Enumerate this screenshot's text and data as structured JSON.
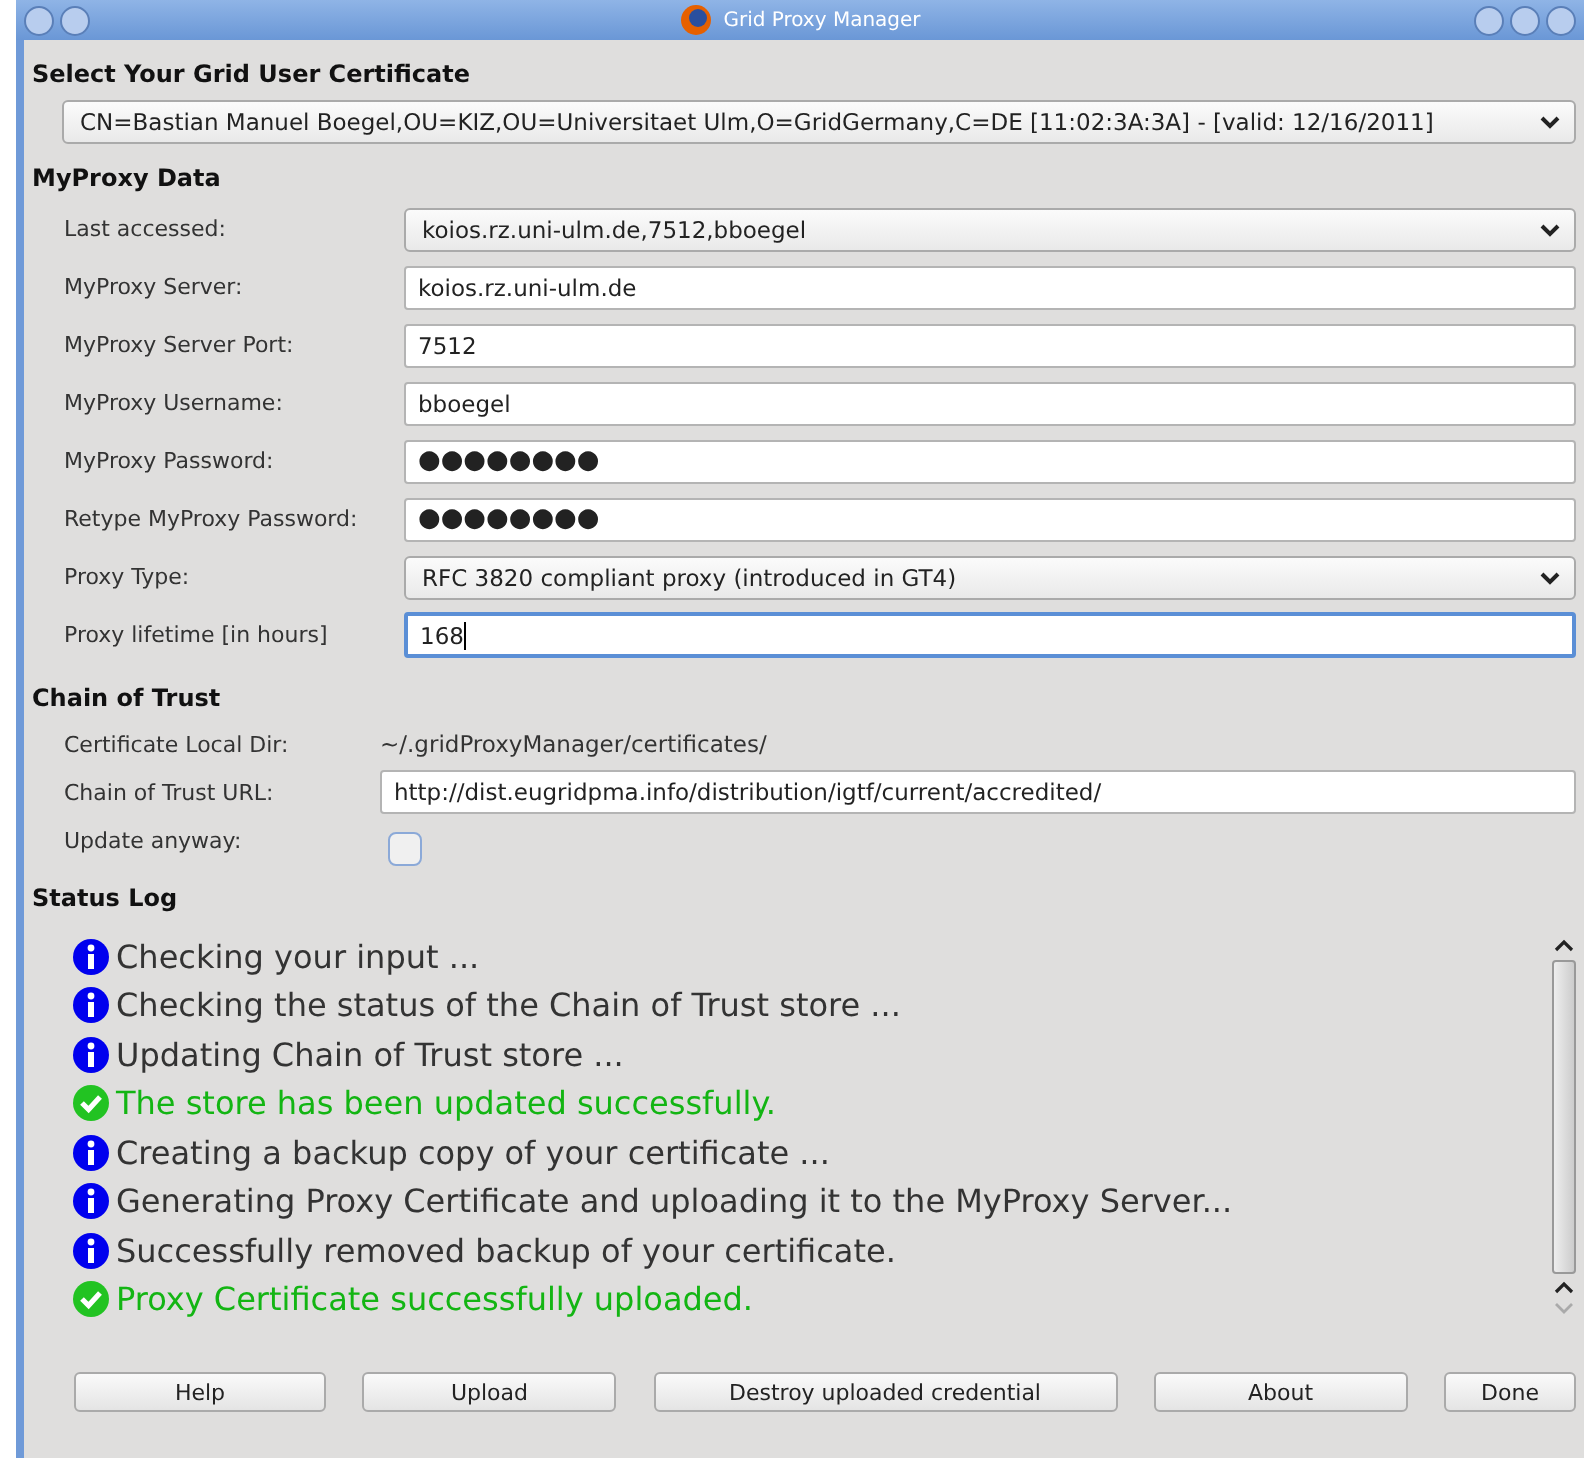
{
  "window": {
    "title": "Grid Proxy Manager"
  },
  "certificate": {
    "heading": "Select Your Grid User Certificate",
    "value": "CN=Bastian Manuel Boegel,OU=KIZ,OU=Universitaet Ulm,O=GridGermany,C=DE [11:02:3A:3A] - [valid: 12/16/2011]"
  },
  "myproxy": {
    "heading": "MyProxy Data",
    "rows": [
      {
        "label": "Last accessed:",
        "kind": "select",
        "value": "koios.rz.uni-ulm.de,7512,bboegel"
      },
      {
        "label": "MyProxy Server:",
        "kind": "text",
        "value": "koios.rz.uni-ulm.de"
      },
      {
        "label": "MyProxy Server Port:",
        "kind": "text",
        "value": "7512"
      },
      {
        "label": "MyProxy Username:",
        "kind": "text",
        "value": "bboegel"
      },
      {
        "label": "MyProxy Password:",
        "kind": "password",
        "value": "●●●●●●●●"
      },
      {
        "label": "Retype MyProxy Password:",
        "kind": "password",
        "value": "●●●●●●●●"
      },
      {
        "label": "Proxy Type:",
        "kind": "select",
        "value": "RFC 3820 compliant proxy (introduced in GT4)"
      },
      {
        "label": "Proxy lifetime [in hours]",
        "kind": "text",
        "value": "168",
        "focused": true
      }
    ]
  },
  "chain_of_trust": {
    "heading": "Chain of Trust",
    "rows": [
      {
        "label": "Certificate Local Dir:",
        "kind": "readonly",
        "value": "~/.gridProxyManager/certificates/"
      },
      {
        "label": "Chain of Trust URL:",
        "kind": "text",
        "value": "http://dist.eugridpma.info/distribution/igtf/current/accredited/"
      },
      {
        "label": "Update anyway:",
        "kind": "checkbox",
        "checked": false
      }
    ]
  },
  "status_log": {
    "heading": "Status Log",
    "entries": [
      {
        "kind": "info",
        "text": "Checking your input ..."
      },
      {
        "kind": "info",
        "text": "Checking the status of the Chain of Trust store ..."
      },
      {
        "kind": "info",
        "text": "Updating Chain of Trust store ..."
      },
      {
        "kind": "success",
        "text": "The store has been updated successfully."
      },
      {
        "kind": "info",
        "text": "Creating a backup copy of your certificate ..."
      },
      {
        "kind": "info",
        "text": "Generating Proxy Certificate and uploading it to the MyProxy Server..."
      },
      {
        "kind": "info",
        "text": "Successfully removed backup of your certificate."
      },
      {
        "kind": "success",
        "text": "Proxy Certificate successfully uploaded."
      }
    ]
  },
  "buttons": [
    "Help",
    "Upload",
    "Destroy uploaded credential",
    "About",
    "Done"
  ]
}
